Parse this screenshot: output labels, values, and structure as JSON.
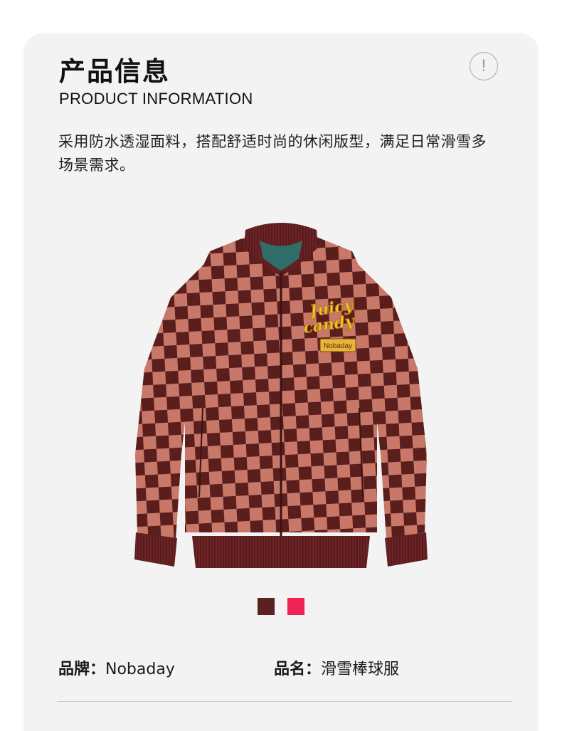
{
  "header": {
    "title": "产品信息",
    "subtitle": "PRODUCT INFORMATION",
    "info_icon": "exclamation-circle-icon",
    "info_glyph": "!"
  },
  "description": "采用防水透湿面料，搭配舒适时尚的休闲版型，满足日常滑雪多场景需求。",
  "product_image": {
    "subject": "checkered bomber ski jacket",
    "patch_line1": "Juicy",
    "patch_line2": "candy",
    "label_patch": "Nobaday"
  },
  "colors": {
    "card_background": "#f3f3f3",
    "jacket_light": "#c87868",
    "jacket_dark": "#5a1e1c",
    "ribbing": "#6b2426",
    "patch_yellow": "#f2c230"
  },
  "swatches": [
    {
      "name": "dark-brown",
      "color": "#5b2020"
    },
    {
      "name": "pink-red",
      "color": "#ef2254"
    }
  ],
  "specs": {
    "brand_label": "品牌：",
    "brand_value": "Nobaday",
    "name_label": "品名：",
    "name_value": "滑雪棒球服"
  }
}
